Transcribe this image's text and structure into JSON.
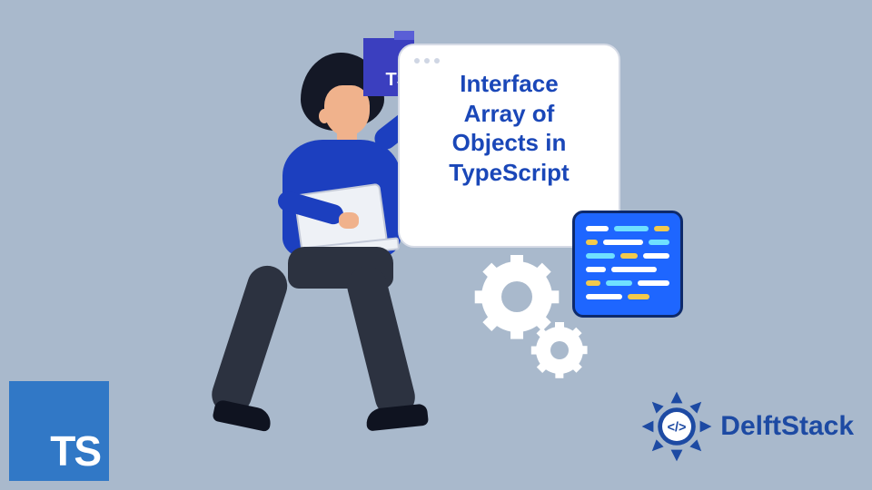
{
  "card": {
    "title_lines": [
      "Interface",
      "Array of",
      "Objects in",
      "TypeScript"
    ]
  },
  "ts_badge": {
    "label": "TS"
  },
  "ts_logo": {
    "label": "TS"
  },
  "delftstack": {
    "label": "DelftStack"
  },
  "colors": {
    "bg": "#a9b9cc",
    "accent_blue": "#1c3fbf",
    "ts_blue": "#3178c6",
    "panel_blue": "#1e66ff",
    "code_white": "#ffffff",
    "code_yellow": "#f2c94c",
    "code_cyan": "#6fe0ff"
  }
}
